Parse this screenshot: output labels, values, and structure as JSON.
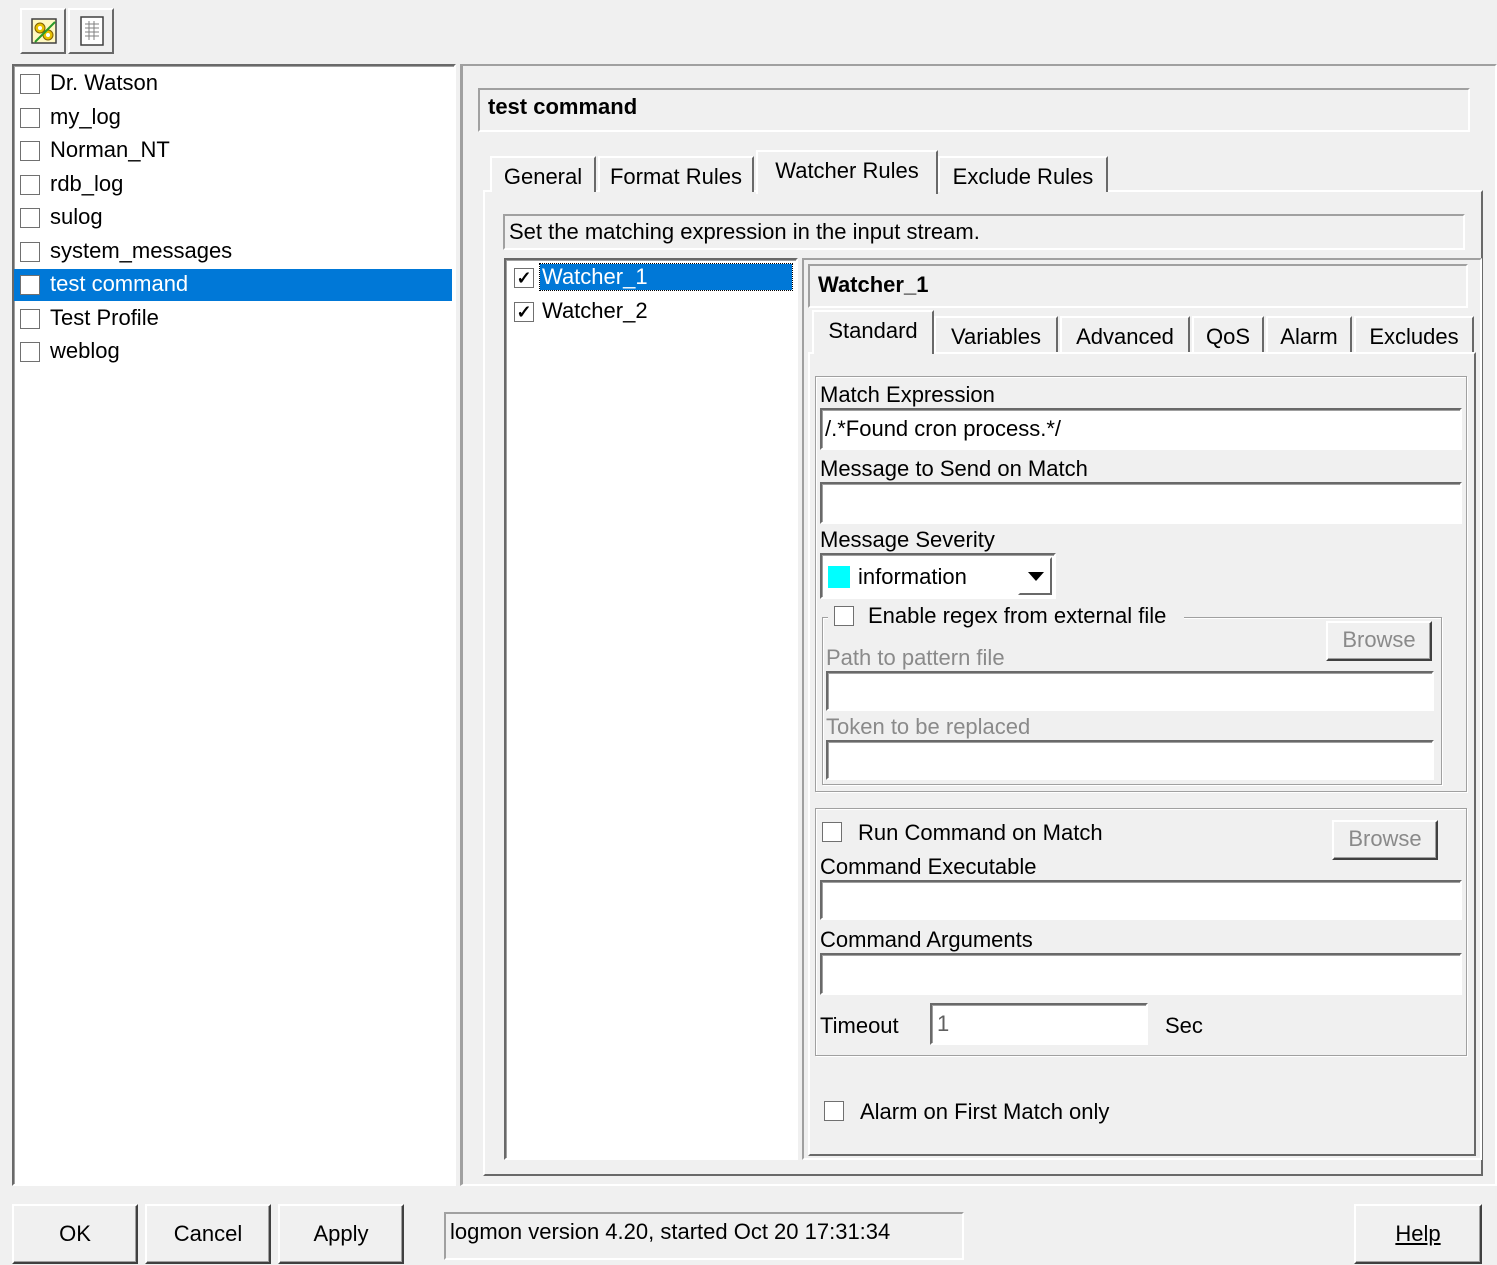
{
  "toolbar": {
    "icons": [
      "new-profile-icon",
      "properties-icon"
    ]
  },
  "profiles": [
    {
      "label": "Dr. Watson",
      "checked": false,
      "selected": false
    },
    {
      "label": "my_log",
      "checked": false,
      "selected": false
    },
    {
      "label": "Norman_NT",
      "checked": false,
      "selected": false
    },
    {
      "label": "rdb_log",
      "checked": false,
      "selected": false
    },
    {
      "label": "sulog",
      "checked": false,
      "selected": false
    },
    {
      "label": "system_messages",
      "checked": false,
      "selected": false
    },
    {
      "label": "test command",
      "checked": true,
      "selected": true
    },
    {
      "label": "Test Profile",
      "checked": false,
      "selected": false
    },
    {
      "label": "weblog",
      "checked": false,
      "selected": false
    }
  ],
  "profile_title": "test command",
  "main_tabs": {
    "general": "General",
    "format_rules": "Format Rules",
    "watcher_rules": "Watcher Rules",
    "exclude_rules": "Exclude Rules",
    "active": "Watcher Rules"
  },
  "watcher_hint": "Set the matching expression in the input stream.",
  "watchers": [
    {
      "label": "Watcher_1",
      "checked": true,
      "selected": true
    },
    {
      "label": "Watcher_2",
      "checked": true,
      "selected": false
    }
  ],
  "watcher_title": "Watcher_1",
  "sub_tabs": {
    "standard": "Standard",
    "variables": "Variables",
    "advanced": "Advanced",
    "qos": "QoS",
    "alarm": "Alarm",
    "excludes": "Excludes",
    "active": "Standard"
  },
  "standard": {
    "match_expression_label": "Match Expression",
    "match_expression_value": "/.*Found cron process.*/",
    "message_label": "Message to Send on Match",
    "message_value": "",
    "severity_label": "Message Severity",
    "severity_value": "information",
    "severity_color": "#00ffff",
    "regex_checkbox_label": "Enable regex from external file",
    "regex_checked": false,
    "regex_browse": "Browse",
    "path_label": "Path to pattern file",
    "path_value": "",
    "token_label": "Token to be replaced",
    "token_value": "",
    "run_command_label": "Run Command on Match",
    "run_command_checked": false,
    "command_browse": "Browse",
    "command_exec_label": "Command Executable",
    "command_exec_value": "",
    "command_args_label": "Command Arguments",
    "command_args_value": "",
    "timeout_label": "Timeout",
    "timeout_value": "1",
    "timeout_unit": "Sec",
    "alarm_first_label": "Alarm on First Match only",
    "alarm_first_checked": false
  },
  "footer": {
    "ok": "OK",
    "cancel": "Cancel",
    "apply": "Apply",
    "status": "logmon version 4.20, started Oct 20 17:31:34",
    "help": "Help"
  }
}
